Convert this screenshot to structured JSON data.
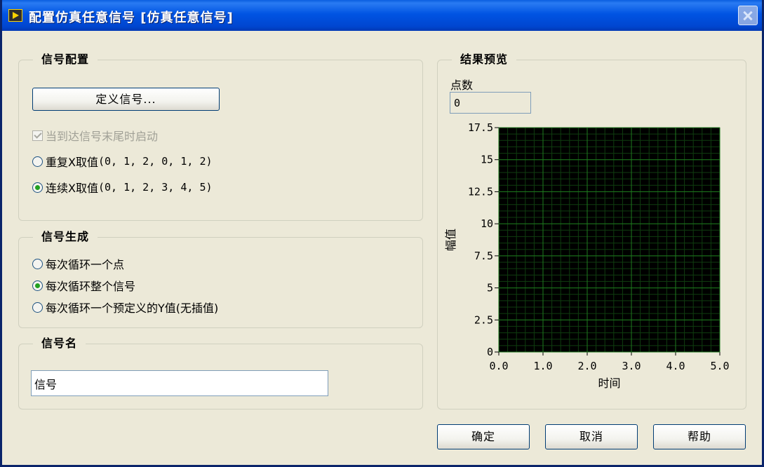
{
  "window": {
    "title": "配置仿真任意信号 [仿真任意信号]"
  },
  "signal_config": {
    "legend": "信号配置",
    "define_button": "定义信号...",
    "start_at_end_checkbox": {
      "label": "当到达信号末尾时启动",
      "checked": true,
      "disabled": true
    },
    "options": [
      {
        "label": "重复X取值",
        "values": "(0, 1, 2, 0, 1, 2)",
        "selected": false
      },
      {
        "label": "连续X取值",
        "values": "(0, 1, 2, 3, 4, 5)",
        "selected": true
      }
    ]
  },
  "signal_generation": {
    "legend": "信号生成",
    "options": [
      {
        "label": "每次循环一个点",
        "selected": false
      },
      {
        "label": "每次循环整个信号",
        "selected": true
      },
      {
        "label": "每次循环一个预定义的Y值(无插值)",
        "selected": false
      }
    ]
  },
  "signal_name": {
    "legend": "信号名",
    "value": "信号"
  },
  "preview": {
    "legend": "结果预览",
    "points_label": "点数",
    "points_value": "0"
  },
  "chart_data": {
    "type": "line",
    "series": [],
    "xlabel": "时间",
    "ylabel": "幅值",
    "xlim": [
      0,
      5
    ],
    "ylim": [
      0,
      17.5
    ],
    "x_ticks": [
      0.0,
      1.0,
      2.0,
      3.0,
      4.0,
      5.0
    ],
    "x_tick_labels": [
      "0.0",
      "1.0",
      "2.0",
      "3.0",
      "4.0",
      "5.0"
    ],
    "y_ticks": [
      0,
      2.5,
      5,
      7.5,
      10,
      12.5,
      15,
      17.5
    ],
    "y_tick_labels": [
      "0",
      "2.5",
      "5",
      "7.5",
      "10",
      "12.5",
      "15",
      "17.5"
    ],
    "grid": true,
    "plot_background": "#000000",
    "grid_color": "#1E7A1E"
  },
  "buttons": {
    "ok": "确定",
    "cancel": "取消",
    "help": "帮助"
  }
}
